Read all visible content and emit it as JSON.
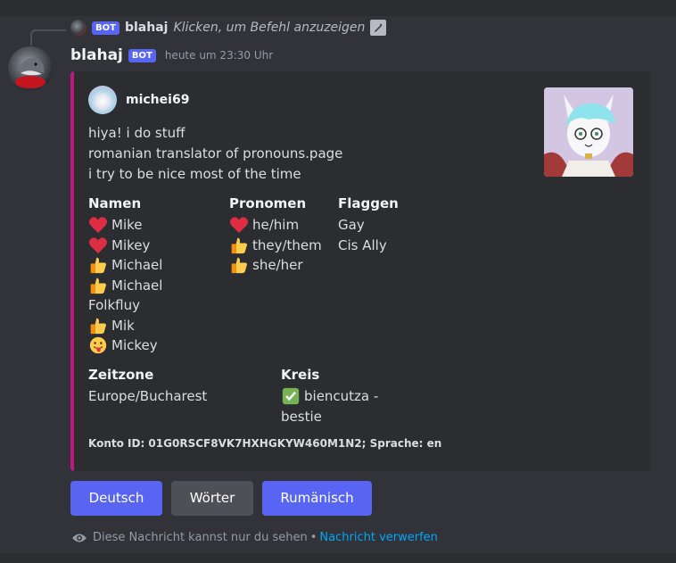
{
  "reply": {
    "bot_tag": "BOT",
    "name": "blahaj",
    "text": "Klicken, um Befehl anzuzeigen"
  },
  "message": {
    "username": "blahaj",
    "bot_tag": "BOT",
    "timestamp": "heute um 23:30 Uhr"
  },
  "embed": {
    "accent_color": "#c3177f",
    "author": "michei69",
    "description": [
      "hiya! i do stuff",
      "romanian translator of pronouns.page",
      "i try to be nice most of the time"
    ],
    "fields": {
      "names": {
        "title": "Namen",
        "items": [
          {
            "icon": "heart",
            "text": "Mike"
          },
          {
            "icon": "heart",
            "text": "Mikey"
          },
          {
            "icon": "thumbs-up",
            "text": "Michael"
          },
          {
            "icon": "thumbs-up",
            "text": "Michael"
          },
          {
            "icon": "",
            "text": "Folkfluy"
          },
          {
            "icon": "thumbs-up",
            "text": "Mik"
          },
          {
            "icon": "tongue-face",
            "text": "Mickey"
          }
        ]
      },
      "pronouns": {
        "title": "Pronomen",
        "items": [
          {
            "icon": "heart",
            "text": "he/him"
          },
          {
            "icon": "thumbs-up",
            "text": "they/them"
          },
          {
            "icon": "thumbs-up",
            "text": "she/her"
          }
        ]
      },
      "flags": {
        "title": "Flaggen",
        "items": [
          "Gay",
          "Cis Ally"
        ]
      },
      "timezone": {
        "title": "Zeitzone",
        "value": "Europe/Bucharest"
      },
      "circle": {
        "title": "Kreis",
        "icon": "check-mark",
        "line1": "biencutza -",
        "line2": "bestie"
      }
    },
    "footer": "Konto ID: 01G0RSCF8VK7HXHGKYW460M1N2; Sprache: en"
  },
  "buttons": [
    {
      "label": "Deutsch",
      "style": "primary"
    },
    {
      "label": "Wörter",
      "style": "secondary"
    },
    {
      "label": "Rumänisch",
      "style": "primary"
    }
  ],
  "ephemeral": {
    "note": "Diese Nachricht kannst nur du sehen",
    "separator": "•",
    "dismiss": "Nachricht verwerfen"
  }
}
